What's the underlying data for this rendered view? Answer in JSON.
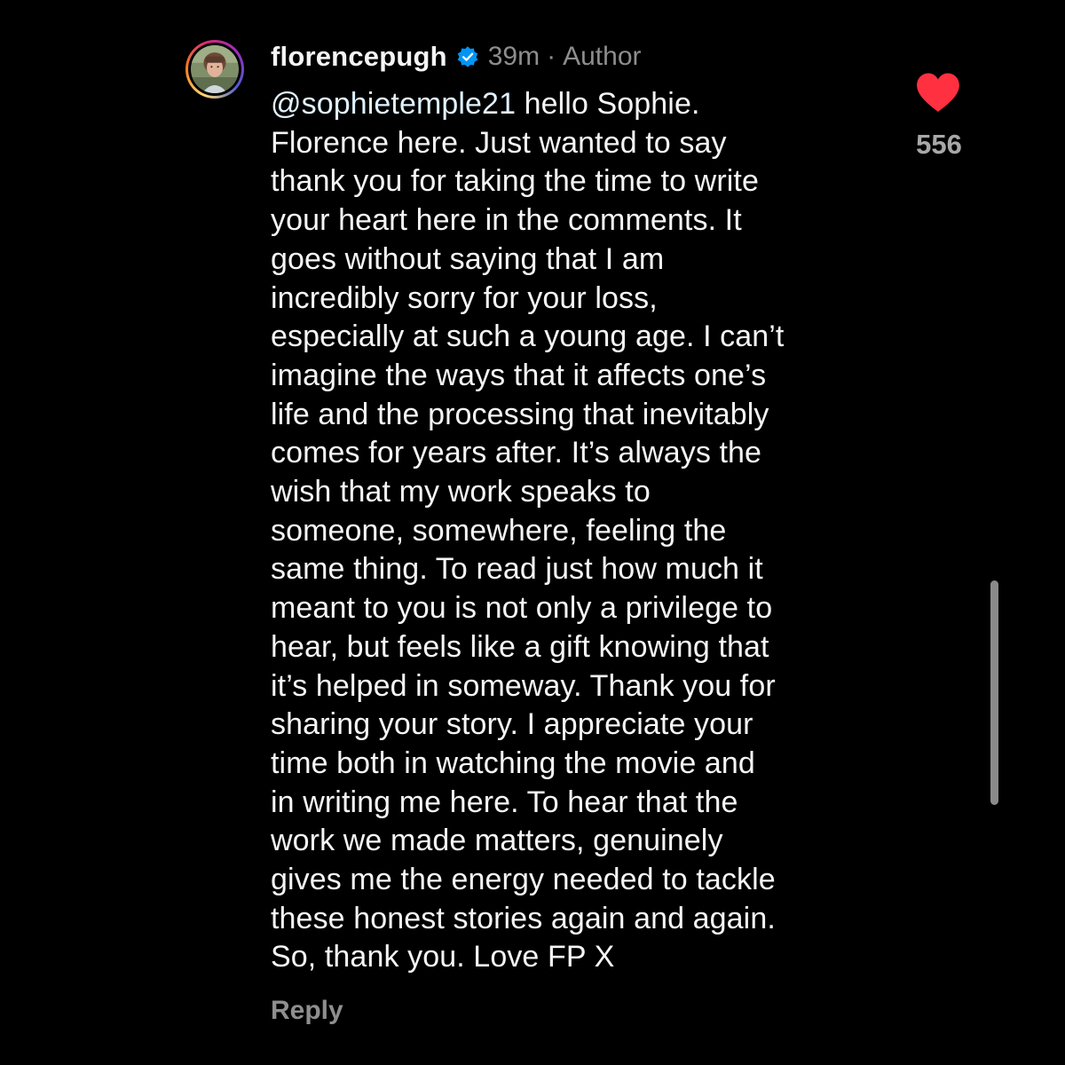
{
  "comment": {
    "username": "florencepugh",
    "time": "39m",
    "separator": "·",
    "role_label": "Author",
    "mention": "@sophietemple21",
    "body": " hello Sophie.\nFlorence here. Just wanted to say\nthank you for taking the time to write\nyour heart here in the comments. It\ngoes without saying that I am\nincredibly sorry for your loss,\nespecially at such a young age. I can’t\nimagine the ways that it affects one’s\nlife and the processing that inevitably\ncomes for years after. It’s always the\nwish that my work speaks to\nsomeone, somewhere, feeling the\nsame thing. To read just how much it\nmeant to you is not only a privilege to\nhear, but feels like a gift knowing that\nit’s helped in someway. Thank you for\nsharing your story. I appreciate your\ntime both in watching the movie and\nin writing me here. To hear that the\nwork we made matters, genuinely\ngives me the energy needed to tackle\nthese honest stories again and again.\nSo, thank you. Love FP X",
    "reply_label": "Reply",
    "like_count": "556"
  },
  "icons": {
    "verified": "verified-badge-icon",
    "like": "heart-icon"
  },
  "colors": {
    "background": "#000000",
    "text": "#f5f5f5",
    "secondary": "#8e8e8e",
    "like": "#ff3040",
    "verified": "#0095f6",
    "mention": "#e0f1ff"
  }
}
